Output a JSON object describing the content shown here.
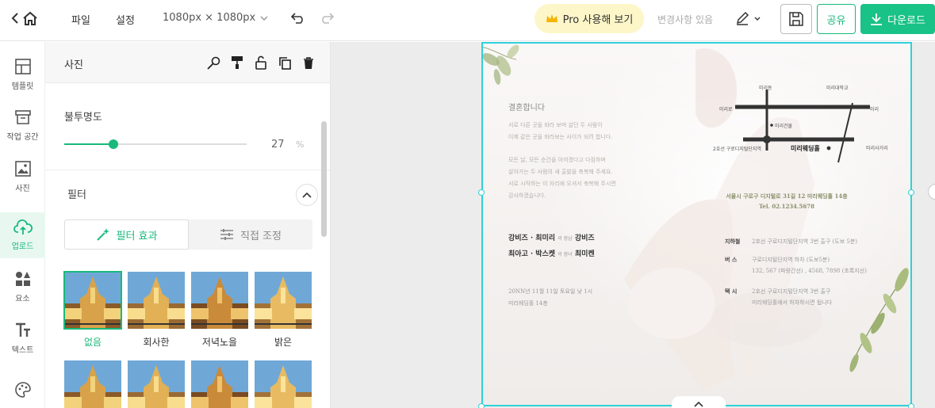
{
  "topbar": {
    "menu_file": "파일",
    "menu_settings": "설정",
    "canvas_size": "1080px × 1080px",
    "pro_label": "Pro 사용해 보기",
    "changes_label": "변경사항 있음",
    "share_label": "공유",
    "download_label": "다운로드"
  },
  "nav": {
    "templates": "템플릿",
    "workspace": "작업 공간",
    "photos": "사진",
    "upload": "업로드",
    "elements": "요소",
    "text": "텍스트"
  },
  "panel": {
    "title": "사진",
    "opacity_label": "불투명도",
    "opacity_value": "27",
    "opacity_unit": "%",
    "opacity_fraction": 0.27,
    "filter_label": "필터",
    "tab_effects": "필터 효과",
    "tab_adjust": "직접 조정",
    "filters": [
      "없음",
      "회사한",
      "저녁노을",
      "밝은"
    ]
  },
  "invitation": {
    "heading": "결혼합니다",
    "para1": [
      "서로 다른 곳을 바라 보며 살던 두 사람이",
      "이제 같은 곳을 바라보는 사이가 되려 합니다."
    ],
    "para2": [
      "모든 날, 모든 순간을 아끼겠다고 다짐하며",
      "살아가는 두 사람의 새 출발을 축복해 주세요.",
      "서로 시작하는 이 자리에 오셔서 축복해 주시면",
      "감사하겠습니다."
    ],
    "groom_parents": "강비즈 · 최미리",
    "groom_rel": "의 장남",
    "groom_name": "강비즈",
    "bride_parents": "최아고 · 박스켓",
    "bride_rel": "의 장녀",
    "bride_name": "최미켄",
    "date_line": "20NN년 11월 11일 토요일 낮 1시",
    "venue_line": "미리웨딩홀 14층",
    "address": "서울시 구로구 디지털로 31길 12 미리웨딩홀 14층",
    "tel": "Tel. 02.1234.5678",
    "map_venue": "미리웨딩홀",
    "transport": [
      {
        "type": "지하철",
        "lines": [
          "2호선 구로디지털단지역 3번 출구 (도보 5분)"
        ]
      },
      {
        "type": "버 스",
        "lines": [
          "구로디지털단지역 하차 (도보5분)",
          "132, 567 (파랑간선) , 4568, 7898 (초록지선)"
        ]
      },
      {
        "type": "택 시",
        "lines": [
          "2호선 구로디지털단지역 3번 출구",
          "미리웨딩홀에서 하차하시면 됩니다"
        ]
      }
    ],
    "map_labels": [
      "미리동",
      "미리대학교",
      "미리로",
      "미리",
      "미리건물",
      "2호선 구로디지털단지역",
      "미리사거리"
    ]
  }
}
